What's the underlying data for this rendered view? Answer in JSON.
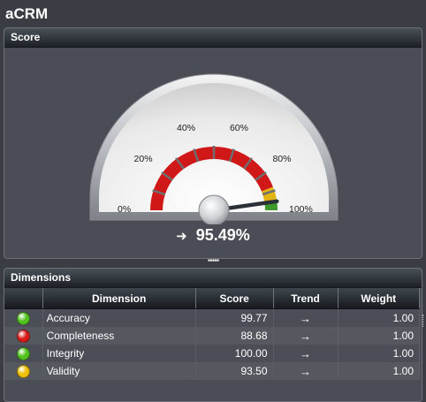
{
  "app": {
    "title": "aCRM"
  },
  "score_panel": {
    "header": "Score",
    "gauge": {
      "value_percent": 95.49,
      "tick_labels": [
        "0%",
        "20%",
        "40%",
        "60%",
        "80%",
        "100%"
      ],
      "band_colors": {
        "red": "#d01818",
        "yellow": "#e2b514",
        "green": "#3d9a2a"
      }
    },
    "score_text": "95.49%",
    "trend_icon": "right-arrow-icon"
  },
  "splitter_glyph": "•••••",
  "dimensions_panel": {
    "header": "Dimensions",
    "columns": [
      "Dimension",
      "Score",
      "Trend",
      "Weight"
    ],
    "rows": [
      {
        "status": "green",
        "name": "Accuracy",
        "score": "99.77",
        "trend": "→",
        "weight": "1.00"
      },
      {
        "status": "red",
        "name": "Completeness",
        "score": "88.68",
        "trend": "→",
        "weight": "1.00"
      },
      {
        "status": "green",
        "name": "Integrity",
        "score": "100.00",
        "trend": "→",
        "weight": "1.00"
      },
      {
        "status": "yellow",
        "name": "Validity",
        "score": "93.50",
        "trend": "→",
        "weight": "1.00"
      }
    ]
  },
  "status_colors": {
    "green": "#4fc21c",
    "red": "#d81a1a",
    "yellow": "#f0c000"
  }
}
